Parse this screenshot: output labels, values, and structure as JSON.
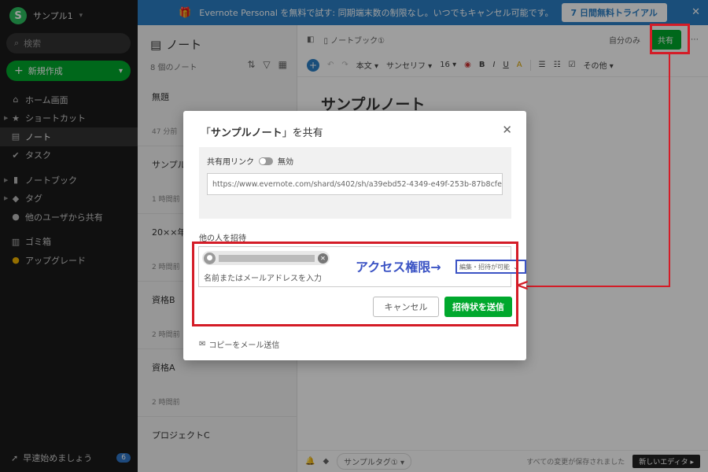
{
  "sidebar": {
    "account_name": "サンプル1",
    "logo_letter": "S",
    "search_placeholder": "検索",
    "new_button": "新規作成",
    "items": [
      {
        "label": "ホーム画面",
        "icon": "home-icon"
      },
      {
        "label": "ショートカット",
        "icon": "star-icon"
      },
      {
        "label": "ノート",
        "icon": "note-icon"
      },
      {
        "label": "タスク",
        "icon": "check-circle-icon"
      },
      {
        "label": "ノートブック",
        "icon": "notebook-icon"
      },
      {
        "label": "タグ",
        "icon": "tag-icon"
      },
      {
        "label": "他のユーザから共有",
        "icon": "users-icon"
      },
      {
        "label": "ゴミ箱",
        "icon": "trash-icon"
      },
      {
        "label": "アップグレード",
        "icon": "upgrade-icon"
      }
    ],
    "quickstart_label": "早速始めましょう",
    "quickstart_badge": "6"
  },
  "banner": {
    "text": "Evernote Personal を無料で試す: 同期端末数の制限なし。いつでもキャンセル可能です。",
    "trial_button": "7 日間無料トライアル"
  },
  "notelist": {
    "title": "ノート",
    "count": "8 個のノート",
    "notes": [
      {
        "title": "無題",
        "date": "47 分前"
      },
      {
        "title": "サンプル",
        "date": "1 時間前"
      },
      {
        "title": "20××年",
        "date": "2 時間前"
      },
      {
        "title": "資格B",
        "date": "2 時間前"
      },
      {
        "title": "資格A",
        "date": "2 時間前"
      },
      {
        "title": "プロジェクトC",
        "date": ""
      }
    ]
  },
  "editor": {
    "notebook": "ノートブック①",
    "only_me": "自分のみ",
    "share_button": "共有",
    "toolbar": {
      "style": "本文",
      "font": "サンセリフ",
      "size": "16",
      "more": "その他"
    },
    "note_title": "サンプルノート",
    "tag_label": "サンプルタグ①",
    "saved_status": "すべての変更が保存されました",
    "new_editor": "新しいエディタ"
  },
  "modal": {
    "title_prefix": "「",
    "title_note": "サンプルノート",
    "title_suffix": "」を共有",
    "share_link_label": "共有用リンク",
    "share_link_state": "無効",
    "share_url": "https://www.evernote.com/shard/s402/sh/a39ebd52-4349-e49f-253b-87b8cfef1...",
    "invite_label": "他の人を招待",
    "invite_placeholder": "名前またはメールアドレスを入力",
    "permission": "編集・招待が可能",
    "cancel_button": "キャンセル",
    "send_button": "招待状を送信",
    "copy_mail": "コピーをメール送信"
  },
  "annotation": {
    "access_label": "アクセス権限→",
    "color": "#d41c27"
  }
}
